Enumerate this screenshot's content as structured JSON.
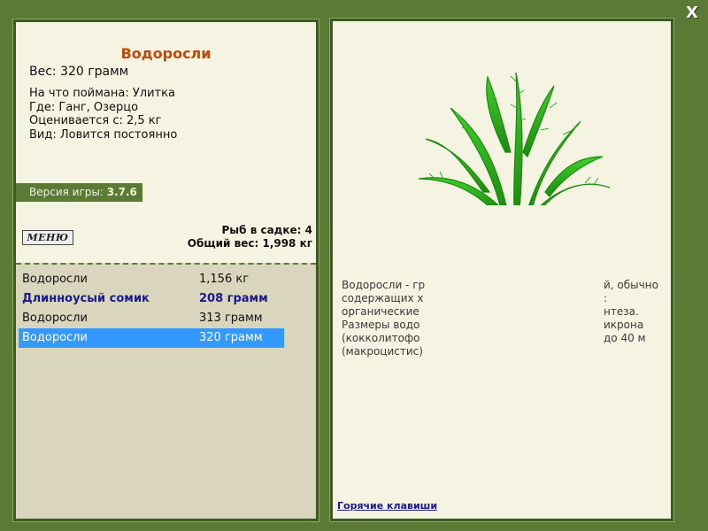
{
  "window": {
    "close_symbol": "X"
  },
  "fish": {
    "title": "Водоросли",
    "weight": "Вес: 320 грамм",
    "bait": "На что поймана: Улитка",
    "location": "Где: Ганг, Озерцо",
    "rated_from": "Оценивается с: 2,5 кг",
    "kind": "Вид: Ловится постоянно"
  },
  "version": {
    "label": "Версия игры:",
    "value": "3.7.6"
  },
  "menu": {
    "label": "МЕНЮ"
  },
  "keepnet": {
    "count": "Рыб в садке: 4",
    "total": "Общий вес: 1,998 кг",
    "catches": [
      {
        "name": "Водоросли",
        "weight": "1,156 кг"
      },
      {
        "name": "Длинноусый сомик",
        "weight": "208 грамм"
      },
      {
        "name": "Водоросли",
        "weight": "313 грамм"
      },
      {
        "name": "Водоросли",
        "weight": "320 грамм"
      }
    ]
  },
  "description": {
    "line1": "Водоросли - гр",
    "line1b": "й, обычно",
    "line2": "содержащих х",
    "line2b": ":",
    "line3": "органические",
    "line3b": "нтеза.",
    "line4": "Размеры водо",
    "line4b": "икрона",
    "line5": "(кокколитофо",
    "line5b": "до 40 м",
    "line6": "(макроцистис)"
  },
  "hotkeys": {
    "label": "Горячие клавиши"
  },
  "icons": {
    "close": "close-icon",
    "plant": "seaweed-image"
  }
}
